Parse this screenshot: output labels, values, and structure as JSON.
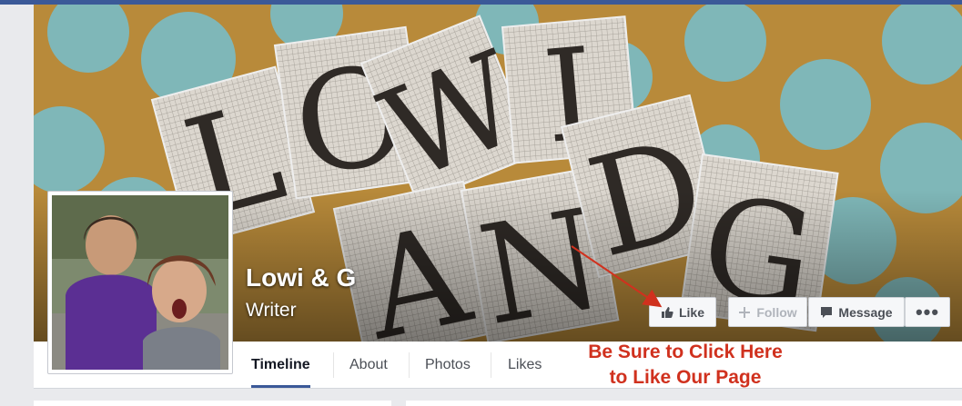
{
  "page": {
    "name": "Lowi & G",
    "category": "Writer"
  },
  "cover": {
    "letters": [
      "L",
      "O",
      "W",
      "I",
      "A",
      "N",
      "D",
      "G"
    ]
  },
  "actions": {
    "like_label": "Like",
    "follow_label": "Follow",
    "message_label": "Message",
    "more_label": "•••"
  },
  "tabs": [
    {
      "label": "Timeline",
      "active": true
    },
    {
      "label": "About"
    },
    {
      "label": "Photos"
    },
    {
      "label": "Likes"
    }
  ],
  "annotation": {
    "line1": "Be Sure to Click Here",
    "line2": "to Like Our Page",
    "color": "#d0311e"
  },
  "colors": {
    "brand": "#3b5998",
    "cover_background": "#b88a3a",
    "dot": "#7fb7b8"
  }
}
